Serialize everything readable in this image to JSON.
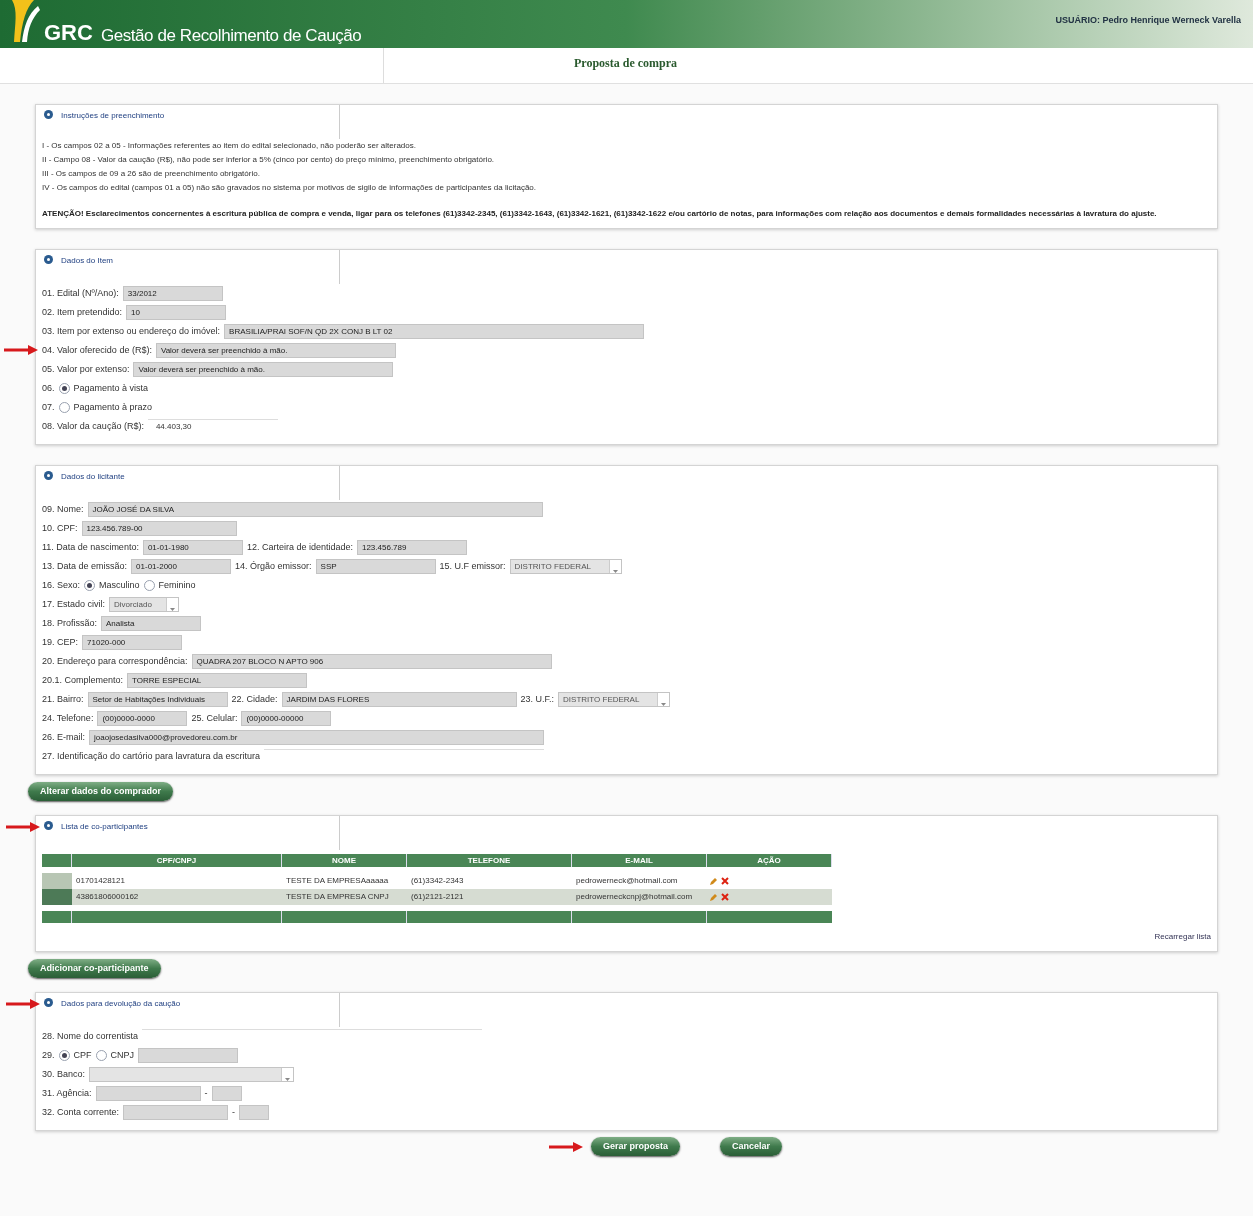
{
  "header": {
    "logo": "GRC",
    "subtitle": "Gestão de Recolhimento de Caução",
    "user": "USUÁRIO: Pedro Henrique Werneck Varella"
  },
  "page_title": "Proposta de compra",
  "sections": [
    {
      "kind": "instructions",
      "title": "Instruções de preenchimento",
      "annotated": false,
      "lines": [
        "I - Os campos 02 a 05 - Informações referentes ao item do edital selecionado, não poderão ser alterados.",
        "II - Campo 08 - Valor da caução (R$), não pode ser inferior a 5% (cinco por cento) do preço mínimo, preenchimento obrigatório.",
        "III - Os campos de 09 a 26 são de preenchimento obrigatório.",
        "IV - Os campos do edital (campos 01 a 05) não são gravados no sistema por motivos de sigilo de informações de participantes da licitação."
      ],
      "notice": "ATENÇÃO! Esclarecimentos concernentes à escritura pública de compra e venda, ligar para os telefones (61)3342-2345, (61)3342-1643, (61)3342-1621, (61)3342-1622 e/ou cartório de notas, para informações com relação aos documentos e demais formalidades necessárias à lavratura do ajuste."
    },
    {
      "kind": "form",
      "title": "Dados do Item",
      "annotated": false,
      "rows": [
        {
          "annotated": false,
          "items": [
            {
              "kind": "label",
              "text": "01. Edital (Nº/Ano):"
            },
            {
              "kind": "field",
              "value": "33/2012"
            }
          ]
        },
        {
          "annotated": false,
          "items": [
            {
              "kind": "label",
              "text": "02. Item pretendido:"
            },
            {
              "kind": "field",
              "value": "10"
            }
          ]
        },
        {
          "annotated": false,
          "items": [
            {
              "kind": "label",
              "text": "03. Item por extenso ou endereço do imóvel:"
            },
            {
              "kind": "field",
              "value": "BRASILIA/PRAI SOF/N QD 2X CONJ B LT 02"
            }
          ]
        },
        {
          "annotated": true,
          "items": [
            {
              "kind": "label",
              "text": "04. Valor oferecido de (R$):"
            },
            {
              "kind": "field",
              "value": "Valor deverá ser preenchido à mão."
            }
          ]
        },
        {
          "annotated": false,
          "items": [
            {
              "kind": "label",
              "text": "05. Valor por extenso:"
            },
            {
              "kind": "field",
              "value": "Valor deverá ser preenchido à mão."
            }
          ]
        },
        {
          "annotated": false,
          "items": [
            {
              "kind": "label",
              "text": "06."
            },
            {
              "kind": "radio",
              "text": "Pagamento à vista",
              "selected": true
            }
          ]
        },
        {
          "annotated": false,
          "items": [
            {
              "kind": "label",
              "text": "07."
            },
            {
              "kind": "radio",
              "text": "Pagamento à prazo",
              "selected": false
            }
          ]
        },
        {
          "annotated": false,
          "items": [
            {
              "kind": "label",
              "text": "08. Valor da caução (R$):"
            },
            {
              "kind": "line",
              "value": "44.403,30"
            }
          ]
        }
      ]
    },
    {
      "kind": "form",
      "title": "Dados do licitante",
      "annotated": false,
      "button": "Alterar dados do comprador",
      "rows": [
        {
          "annotated": false,
          "items": [
            {
              "kind": "label",
              "text": "09. Nome:"
            },
            {
              "kind": "field",
              "value": "JOÃO JOSÉ DA SILVA"
            }
          ]
        },
        {
          "annotated": false,
          "items": [
            {
              "kind": "label",
              "text": "10. CPF:"
            },
            {
              "kind": "field",
              "value": "123.456.789-00"
            }
          ]
        },
        {
          "annotated": false,
          "items": [
            {
              "kind": "label",
              "text": "11. Data de nascimento:"
            },
            {
              "kind": "field",
              "value": "01-01-1980"
            },
            {
              "kind": "label",
              "text": "12. Carteira de identidade:"
            },
            {
              "kind": "field",
              "value": "123.456.789"
            }
          ]
        },
        {
          "annotated": false,
          "items": [
            {
              "kind": "label",
              "text": "13. Data de emissão:"
            },
            {
              "kind": "field",
              "value": "01-01-2000"
            },
            {
              "kind": "label",
              "text": "14. Órgão emissor:"
            },
            {
              "kind": "field",
              "value": "SSP"
            },
            {
              "kind": "label",
              "text": "15. U.F emissor:"
            },
            {
              "kind": "select",
              "value": "DISTRITO FEDERAL"
            }
          ]
        },
        {
          "annotated": false,
          "items": [
            {
              "kind": "label",
              "text": "16. Sexo:"
            },
            {
              "kind": "radio",
              "text": "Masculino",
              "selected": true
            },
            {
              "kind": "radio",
              "text": "Feminino",
              "selected": false
            }
          ]
        },
        {
          "annotated": false,
          "items": [
            {
              "kind": "label",
              "text": "17. Estado civil:"
            },
            {
              "kind": "select",
              "value": "Divorciado"
            }
          ]
        },
        {
          "annotated": false,
          "items": [
            {
              "kind": "label",
              "text": "18. Profissão:"
            },
            {
              "kind": "field",
              "value": "Analista"
            }
          ]
        },
        {
          "annotated": false,
          "items": [
            {
              "kind": "label",
              "text": "19. CEP:"
            },
            {
              "kind": "field",
              "value": "71020-000"
            }
          ]
        },
        {
          "annotated": false,
          "items": [
            {
              "kind": "label",
              "text": "20. Endereço para correspondência:"
            },
            {
              "kind": "field",
              "value": "QUADRA 207 BLOCO N APTO 906"
            }
          ]
        },
        {
          "annotated": false,
          "items": [
            {
              "kind": "label",
              "text": "20.1. Complemento:"
            },
            {
              "kind": "field",
              "value": "TORRE ESPECIAL"
            }
          ]
        },
        {
          "annotated": false,
          "items": [
            {
              "kind": "label",
              "text": "21. Bairro:"
            },
            {
              "kind": "field",
              "value": "Setor de Habitações Individuais"
            },
            {
              "kind": "label",
              "text": "22. Cidade:"
            },
            {
              "kind": "field",
              "value": "JARDIM DAS FLORES"
            },
            {
              "kind": "label",
              "text": "23. U.F.:"
            },
            {
              "kind": "select",
              "value": "DISTRITO FEDERAL"
            }
          ]
        },
        {
          "annotated": false,
          "items": [
            {
              "kind": "label",
              "text": "24. Telefone:"
            },
            {
              "kind": "field",
              "value": "(00)0000-0000"
            },
            {
              "kind": "label",
              "text": "25. Celular:"
            },
            {
              "kind": "field",
              "value": "(00)0000-00000"
            }
          ]
        },
        {
          "annotated": false,
          "items": [
            {
              "kind": "label",
              "text": "26. E-mail:"
            },
            {
              "kind": "field",
              "value": "joaojosedasilva000@provedoreu.com.br"
            }
          ]
        },
        {
          "annotated": false,
          "items": [
            {
              "kind": "label",
              "text": "27. Identificação do cartório para lavratura da escritura"
            },
            {
              "kind": "line"
            }
          ]
        }
      ]
    },
    {
      "kind": "table",
      "title": "Lista de co-participantes",
      "annotated": true,
      "button": "Adicionar co-participante",
      "reload": "Recarregar lista",
      "columns": [
        "CPF/CNPJ",
        "NOME",
        "TELEFONE",
        "E-MAIL",
        "AÇÃO"
      ],
      "rows": [
        {
          "selected": false,
          "cells": [
            "01701428121",
            "TESTE DA EMPRESAaaaaa",
            "(61)3342-2343",
            "pedrowerneck@hotmail.com"
          ]
        },
        {
          "selected": true,
          "cells": [
            "43861806000162",
            "TESTE DA EMPRESA CNPJ",
            "(61)2121-2121",
            "pedrowerneckcnpj@hotmail.com"
          ]
        }
      ]
    },
    {
      "kind": "form",
      "title": "Dados para devolução da caução",
      "annotated": true,
      "rows": [
        {
          "annotated": false,
          "items": [
            {
              "kind": "label",
              "text": "28. Nome do correntista"
            },
            {
              "kind": "line"
            }
          ]
        },
        {
          "annotated": false,
          "items": [
            {
              "kind": "label",
              "text": "29."
            },
            {
              "kind": "radio",
              "text": "CPF",
              "selected": true
            },
            {
              "kind": "radio",
              "text": "CNPJ",
              "selected": false
            },
            {
              "kind": "field"
            }
          ]
        },
        {
          "annotated": false,
          "items": [
            {
              "kind": "label",
              "text": "30. Banco:"
            },
            {
              "kind": "select"
            }
          ]
        },
        {
          "annotated": false,
          "items": [
            {
              "kind": "label",
              "text": "31. Agência:"
            },
            {
              "kind": "field"
            },
            {
              "kind": "label",
              "text": "-"
            },
            {
              "kind": "field"
            }
          ]
        },
        {
          "annotated": false,
          "items": [
            {
              "kind": "label",
              "text": "32. Conta corrente:"
            },
            {
              "kind": "field"
            },
            {
              "kind": "label",
              "text": "-"
            },
            {
              "kind": "field"
            }
          ]
        }
      ]
    }
  ],
  "actions": [
    {
      "label": "Gerar proposta",
      "annotated": true
    },
    {
      "label": "Cancelar",
      "annotated": false
    }
  ]
}
